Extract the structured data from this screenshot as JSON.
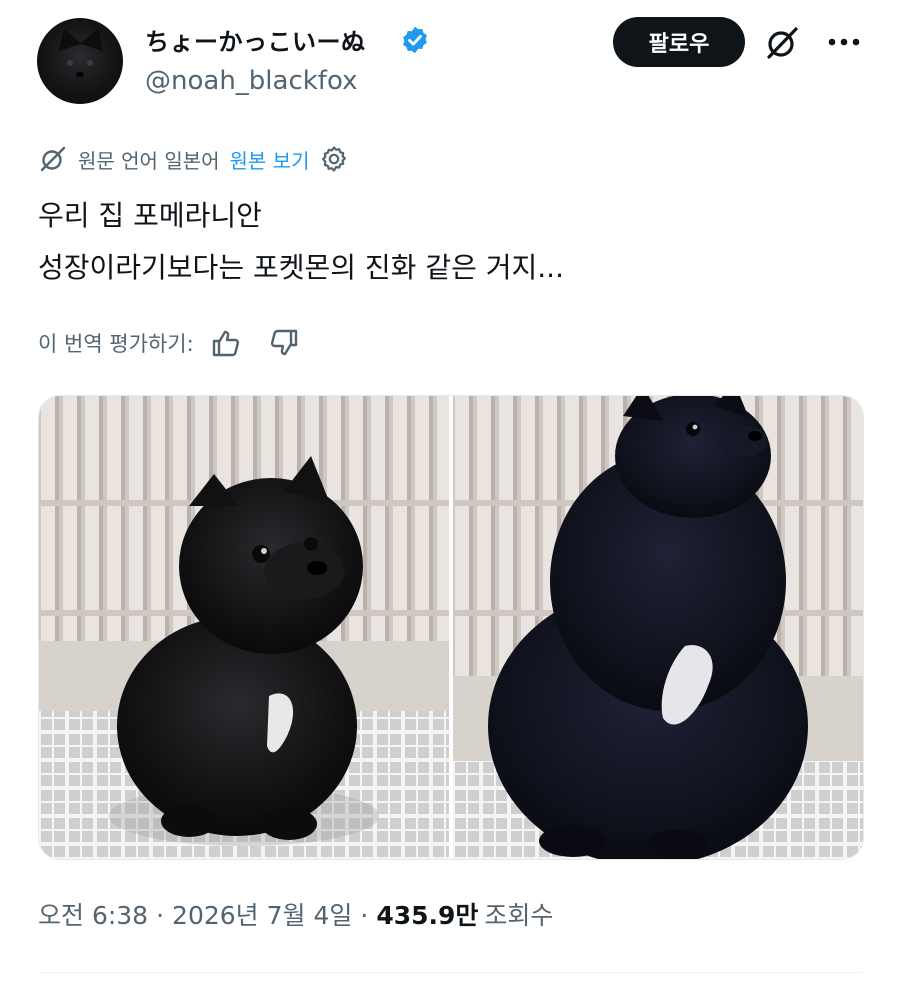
{
  "header": {
    "display_name": "ちょーかっこいーぬ",
    "handle": "@noah_blackfox",
    "follow_label": "팔로우"
  },
  "translation": {
    "notice": "원문 언어 일본어",
    "show_original_label": "원본 보기"
  },
  "tweet": {
    "line1": "우리 집 포메라니안",
    "line2": "성장이라기보다는 포켓몬의 진화 같은 거지..."
  },
  "rate": {
    "label": "이 번역 평가하기:"
  },
  "meta": {
    "time": "오전 6:38",
    "separator": "·",
    "date": "2026년 7월 4일",
    "views_count": "435.9만",
    "views_label": "조회수"
  },
  "colors": {
    "text_primary": "#0f1419",
    "text_secondary": "#536471",
    "link": "#1d9bf0",
    "verified_badge": "#1d9bf0",
    "follow_button_bg": "#0f1419"
  },
  "icons": {
    "verified": "verified-badge-icon",
    "grok": "grok-icon",
    "more": "more-icon",
    "translate": "translate-icon",
    "settings": "gear-icon",
    "thumbs_up": "thumbs-up-icon",
    "thumbs_down": "thumbs-down-icon"
  }
}
